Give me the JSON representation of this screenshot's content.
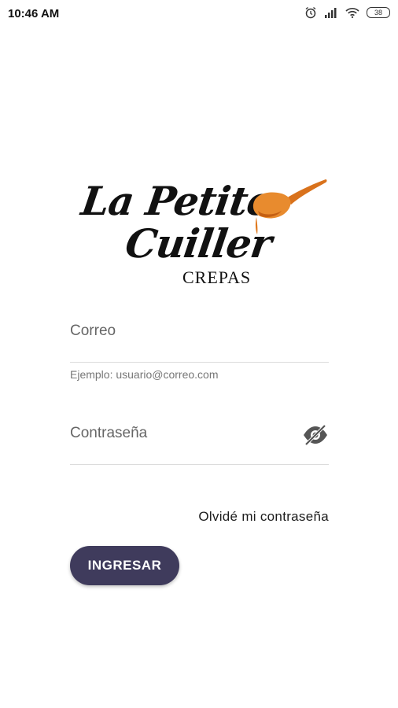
{
  "status_bar": {
    "time": "10:46 AM",
    "battery": "38",
    "icons": [
      "alarm-icon",
      "signal-icon",
      "wifi-icon",
      "battery-icon"
    ]
  },
  "logo": {
    "line1": "La Petite",
    "line2": "Cuiller",
    "subtitle": "CREPAS",
    "accent_color": "#e07a1f"
  },
  "form": {
    "email": {
      "placeholder": "Correo",
      "value": "",
      "helper": "Ejemplo: usuario@correo.com"
    },
    "password": {
      "placeholder": "Contraseña",
      "value": "",
      "toggle_icon": "eye-off-icon"
    },
    "forgot_label": "Olvidé mi contraseña",
    "submit_label": "INGRESAR",
    "button_color": "#3f3b5c"
  }
}
